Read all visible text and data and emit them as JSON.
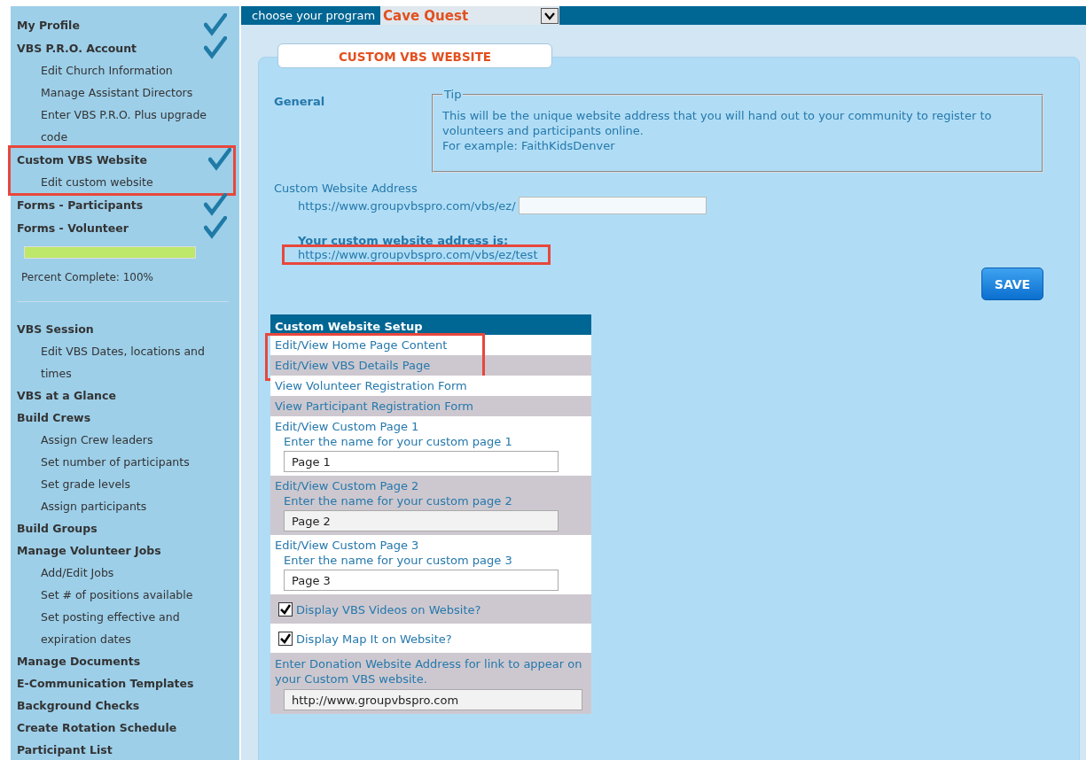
{
  "sidebar": {
    "top_items": [
      {
        "label": "My Profile",
        "checked": true,
        "highlighted": false
      },
      {
        "label": "VBS P.R.O. Account",
        "checked": true,
        "highlighted": false,
        "children": [
          {
            "label": "Edit Church Information"
          },
          {
            "label": "Manage Assistant Directors"
          },
          {
            "label": "Enter VBS P.R.O. Plus upgrade code"
          }
        ]
      },
      {
        "label": "Custom VBS Website",
        "checked": true,
        "highlighted": true,
        "children": [
          {
            "label": "Edit custom website"
          }
        ]
      },
      {
        "label": "Forms - Participants",
        "checked": true,
        "highlighted": false
      },
      {
        "label": "Forms - Volunteer",
        "checked": true,
        "highlighted": false
      }
    ],
    "progress": {
      "level": 1,
      "label": "Percent Complete: 100%"
    },
    "items": [
      {
        "label": "VBS Session",
        "children": [
          {
            "label": "Edit VBS Dates, locations and times"
          }
        ]
      },
      {
        "label": "VBS at a Glance"
      },
      {
        "label": "Build Crews",
        "children": [
          {
            "label": "Assign Crew leaders"
          },
          {
            "label": "Set number of participants"
          },
          {
            "label": "Set grade levels"
          },
          {
            "label": "Assign participants"
          }
        ]
      },
      {
        "label": "Build Groups"
      },
      {
        "label": "Manage Volunteer Jobs",
        "children": [
          {
            "label": "Add/Edit Jobs"
          },
          {
            "label": "Set # of positions available"
          },
          {
            "label": "Set posting effective and expiration dates"
          }
        ]
      },
      {
        "label": "Manage Documents"
      },
      {
        "label": "E-Communication Templates"
      },
      {
        "label": "Background Checks"
      },
      {
        "label": "Create Rotation Schedule"
      },
      {
        "label": "Participant List"
      }
    ]
  },
  "top_bar": {
    "label": "choose your program",
    "program": "Cave Quest"
  },
  "panel": {
    "tab": "CUSTOM VBS WEBSITE",
    "section": "General",
    "tip": {
      "legend": "Tip",
      "lines": [
        "This will be the unique website address that you will hand out to your community to register to volunteers and participants online.",
        "For example: FaithKidsDenver"
      ]
    },
    "address_label": "Custom Website Address",
    "address_prefix": "https://www.groupvbspro.com/vbs/ez/",
    "result_label": "Your custom website address is:",
    "result_link": "https://www.groupvbspro.com/vbs/ez/test",
    "result_highlighted": true,
    "save": "SAVE"
  },
  "setup": {
    "title": "Custom Website Setup",
    "rows": [
      {
        "kind": "link",
        "link": "Edit/View Home Page Content",
        "highlighted": true
      },
      {
        "kind": "link",
        "link": "Edit/View VBS Details Page",
        "highlighted": true
      },
      {
        "kind": "link",
        "link": "View Volunteer Registration Form",
        "highlighted": false
      },
      {
        "kind": "link",
        "link": "View Participant Registration Form",
        "highlighted": false
      },
      {
        "kind": "page",
        "link": "Edit/View Custom Page 1",
        "label": "Enter the name for your custom page 1",
        "value": "Page 1",
        "highlighted": false
      },
      {
        "kind": "page",
        "link": "Edit/View Custom Page 2",
        "label": "Enter the name for your custom page 2",
        "value": "Page 2",
        "highlighted": false
      },
      {
        "kind": "page",
        "link": "Edit/View Custom Page 3",
        "label": "Enter the name for your custom page 3",
        "value": "Page 3",
        "highlighted": false
      },
      {
        "kind": "checkbox",
        "label": "Display VBS Videos on Website?",
        "checked": true,
        "highlighted": false
      },
      {
        "kind": "checkbox",
        "label": "Display Map It on Website?",
        "checked": true,
        "highlighted": false
      },
      {
        "kind": "donation",
        "label": "Enter Donation Website Address for link to appear on your Custom VBS website.",
        "value": "http://www.groupvbspro.com",
        "highlighted": false
      }
    ]
  }
}
